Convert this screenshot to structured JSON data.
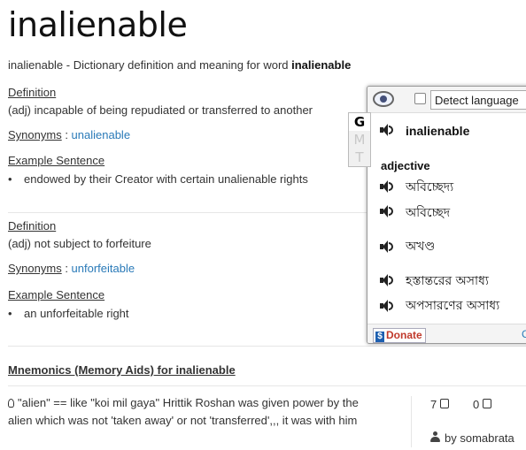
{
  "page": {
    "title": "inalienable",
    "subtitle_prefix": "inalienable - Dictionary definition and meaning for word ",
    "subtitle_word": "inalienable"
  },
  "senses": [
    {
      "definition_label": "Definition",
      "definition": "(adj) incapable of being repudiated or transferred to another",
      "synonyms_label": "Synonyms",
      "synonyms_sep": " : ",
      "synonym": "unalienable",
      "example_label": "Example Sentence",
      "example": "endowed by their Creator with certain unalienable rights"
    },
    {
      "definition_label": "Definition",
      "definition": "(adj) not subject to forfeiture",
      "synonyms_label": "Synonyms",
      "synonyms_sep": " : ",
      "synonym": "unforfeitable",
      "example_label": "Example Sentence",
      "example": "an unforfeitable right"
    }
  ],
  "mnemonics": {
    "title": "Mnemonics (Memory Aids) for inalienable",
    "line1": "\"alien\" == like \"koi mil gaya\" Hrittik Roshan was given power by the",
    "line2": "alien which was not 'taken away' or not 'transferred',,, it was with him",
    "upvotes": "7",
    "downvotes": "0",
    "author_prefix": "by ",
    "author": "somabrata"
  },
  "popup": {
    "detect_label": "Detect language",
    "side_tabs": [
      "G",
      "M",
      "T"
    ],
    "word": "inalienable",
    "part_of_speech": "adjective",
    "translations": [
      "অবিচ্ছেদ্য",
      "অবিচ্ছেদ",
      "অখণ্ড",
      "হস্তান্তরের অসাধ্য",
      "অপসারণের অসাধ্য"
    ],
    "donate_label": "Donate",
    "footer_partial": "C"
  },
  "colors": {
    "link_blue": "#2a7ab8",
    "text": "#333333",
    "donate_red": "#c0392b"
  },
  "icons": [
    "speaker-icon",
    "chat-bubble-icon",
    "lightbulb-icon",
    "thumbs-up-icon",
    "thumbs-down-icon",
    "user-icon",
    "paypal-icon"
  ]
}
